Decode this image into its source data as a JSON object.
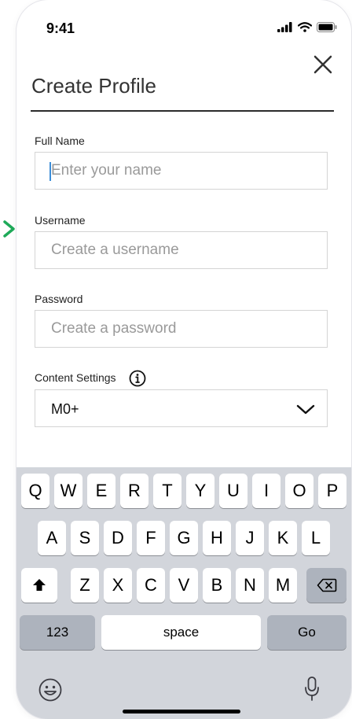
{
  "status_bar": {
    "time": "9:41"
  },
  "header": {
    "title": "Create Profile"
  },
  "form": {
    "full_name": {
      "label": "Full Name",
      "placeholder": "Enter your name"
    },
    "username": {
      "label": "Username",
      "placeholder": "Create a username"
    },
    "password": {
      "label": "Password",
      "placeholder": "Create a password"
    },
    "content_settings": {
      "label": "Content Settings",
      "value": "M0+"
    }
  },
  "keyboard": {
    "row1": [
      "Q",
      "W",
      "E",
      "R",
      "T",
      "Y",
      "U",
      "I",
      "O",
      "P"
    ],
    "row2": [
      "A",
      "S",
      "D",
      "F",
      "G",
      "H",
      "J",
      "K",
      "L"
    ],
    "row3": [
      "Z",
      "X",
      "C",
      "V",
      "B",
      "N",
      "M"
    ],
    "numbers_label": "123",
    "space_label": "space",
    "go_label": "Go"
  },
  "icons": {
    "close": "close-icon",
    "info": "info-icon",
    "chevron": "chevron-down-icon",
    "shift": "shift-icon",
    "backspace": "backspace-icon",
    "emoji": "emoji-icon",
    "mic": "microphone-icon",
    "annotation_arrow": "arrow-right-icon"
  },
  "colors": {
    "accent_arrow": "#1faa59",
    "cursor": "#3d8ed8",
    "keyboard_bg": "#d2d5db",
    "key_dark": "#adb3bd"
  }
}
